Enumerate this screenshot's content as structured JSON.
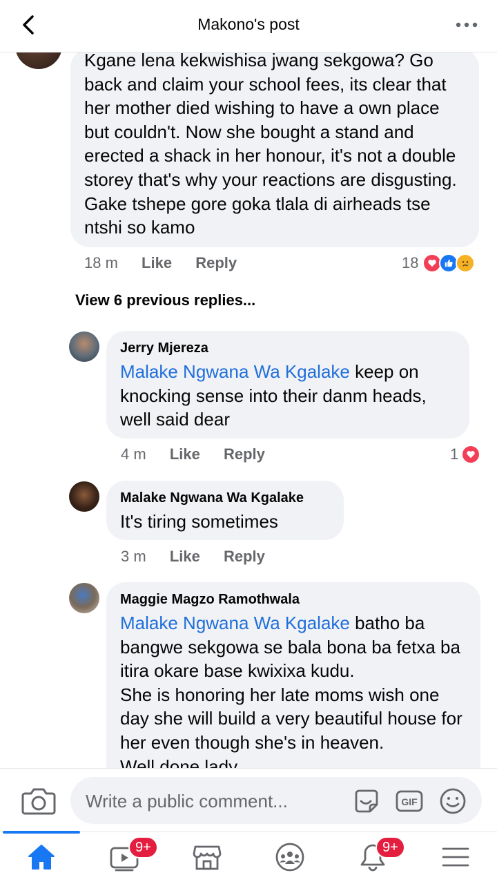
{
  "header": {
    "title": "Makono's post"
  },
  "comments": [
    {
      "text": "Kgane lena kekwishisa jwang sekgowa? Go back and claim your school fees, its clear that her mother died wishing to have a own place but couldn't. Now she bought a stand and erected a shack in her honour, it's not a double storey that's why your reactions are disgusting. Gake tshepe gore goka tlala di airheads tse ntshi so kamo",
      "time": "18 m",
      "like_label": "Like",
      "reply_label": "Reply",
      "reaction_count": "18",
      "reactions": [
        "love-icon",
        "like-icon",
        "sad-icon"
      ]
    }
  ],
  "view_previous": "View 6 previous replies...",
  "replies": [
    {
      "name": "Jerry Mjereza",
      "mention": "Malake Ngwana Wa Kgalake",
      "text": " keep on knocking sense into their danm heads, well said dear",
      "time": "4 m",
      "like_label": "Like",
      "reply_label": "Reply",
      "reaction_count": "1",
      "reactions": [
        "love-icon"
      ]
    },
    {
      "name": "Malake Ngwana Wa Kgalake",
      "mention": "",
      "text": "It's tiring sometimes",
      "time": "3 m",
      "like_label": "Like",
      "reply_label": "Reply"
    },
    {
      "name": "Maggie Magzo Ramothwala",
      "mention": "Malake Ngwana Wa Kgalake",
      "text": " batho ba bangwe sekgowa se bala bona ba fetxa ba itira okare base kwixixa kudu.\nShe is honoring her late moms wish one day she will build a very beautiful house for her even though she's in heaven.\nWell done lady"
    }
  ],
  "composer": {
    "placeholder": "Write a public comment...",
    "icons": [
      "camera-icon",
      "sticker-icon",
      "gif-icon",
      "emoji-icon"
    ]
  },
  "tabbar": {
    "tabs": [
      "home-icon",
      "watch-icon",
      "marketplace-icon",
      "groups-icon",
      "notifications-icon",
      "menu-icon"
    ],
    "watch_badge": "9+",
    "notifications_badge": "9+"
  },
  "colors": {
    "accent": "#1877f2",
    "mention": "#216fdb",
    "badge": "#e41e3f",
    "bubble": "#f0f2f5"
  }
}
